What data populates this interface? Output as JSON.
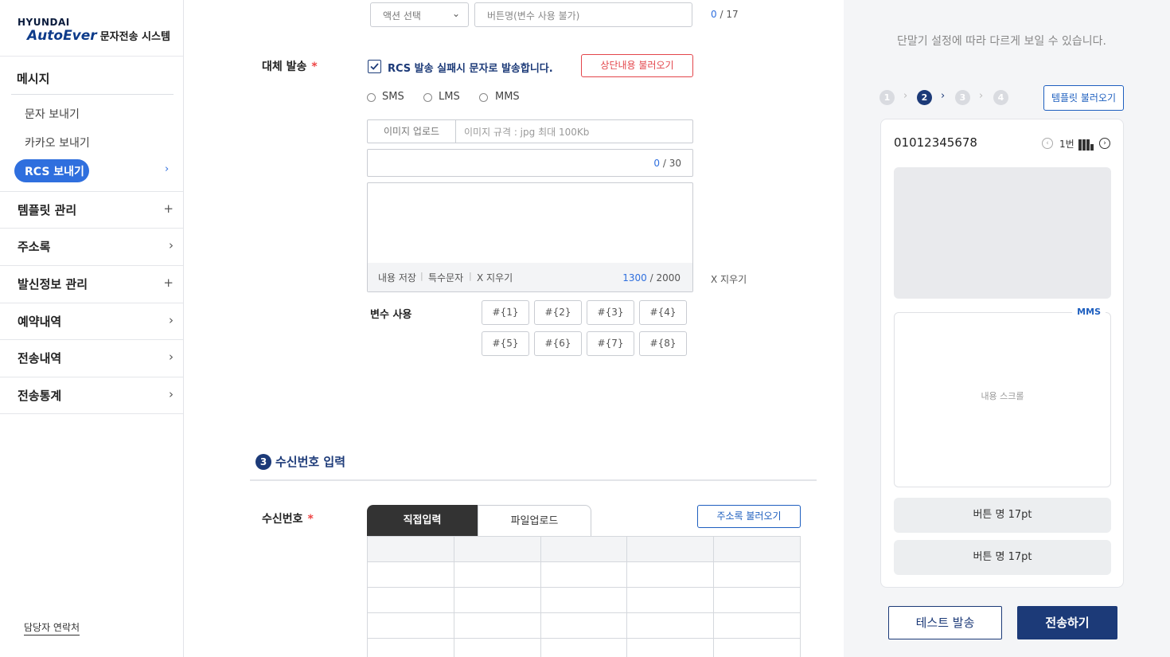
{
  "brand": {
    "hyundai": "HYUNDAI",
    "autoever": "AutoEver",
    "system": "문자전송 시스템"
  },
  "sidebar": {
    "section": "메시지",
    "sub_items": [
      {
        "label": "문자 보내기"
      },
      {
        "label": "카카오 보내기"
      },
      {
        "label": "RCS 보내기",
        "active": true
      }
    ],
    "items": [
      {
        "label": "템플릿 관리",
        "icon": "+"
      },
      {
        "label": "주소록",
        "icon": "›"
      },
      {
        "label": "발신정보 관리",
        "icon": "+"
      },
      {
        "label": "예약내역",
        "icon": "›"
      },
      {
        "label": "전송내역",
        "icon": "›"
      },
      {
        "label": "전송통계",
        "icon": "›"
      }
    ],
    "contact": "담당자 연락처"
  },
  "form": {
    "action_select": "액션 선택",
    "button_name_placeholder": "버튼명(변수 사용 불가)",
    "button_name_count": "0",
    "button_name_max": "/ 17",
    "alt_send_label": "대체 발송",
    "required_mark": "*",
    "alt_send_check": "RCS 발송 실패시 문자로 발송합니다.",
    "load_above_button": "상단내용 불러오기",
    "radio": [
      "SMS",
      "LMS",
      "MMS"
    ],
    "image_upload_button": "이미지 업로드",
    "image_spec": "이미지 규격 : jpg 최대 100Kb",
    "title_count": "0",
    "title_max": "/ 30",
    "textarea_actions": {
      "save": "내용 저장",
      "special": "특수문자",
      "clear": "X  지우기"
    },
    "separator": "|",
    "content_count": "1300",
    "content_max": "/ 2000",
    "clear_right": "X  지우기",
    "variables_label": "변수 사용",
    "variables": [
      "#{1}",
      "#{2}",
      "#{3}",
      "#{4}",
      "#{5}",
      "#{6}",
      "#{7}",
      "#{8}"
    ]
  },
  "recipients": {
    "section_number": "3",
    "section_title": "수신번호 입력",
    "label": "수신번호",
    "tabs": [
      "직접입력",
      "파일업로드"
    ],
    "address_book_button": "주소록 불러오기"
  },
  "preview": {
    "note": "단말기 설정에 따라 다르게 보일 수 있습니다.",
    "steps": [
      "1",
      "2",
      "3",
      "4"
    ],
    "active_step": "2",
    "template_button": "템플릿 불러오기",
    "phone_number": "01012345678",
    "page": "1번",
    "type_label": "MMS",
    "scroll_hint": "내용 스크롤",
    "buttons": [
      "버튼 명 17pt",
      "버튼 명 17pt"
    ]
  },
  "actions": {
    "test": "테스트 발송",
    "send": "전송하기"
  },
  "colors": {
    "primary": "#1c3a78",
    "accent": "#2f6fde",
    "danger": "#e3454b"
  }
}
